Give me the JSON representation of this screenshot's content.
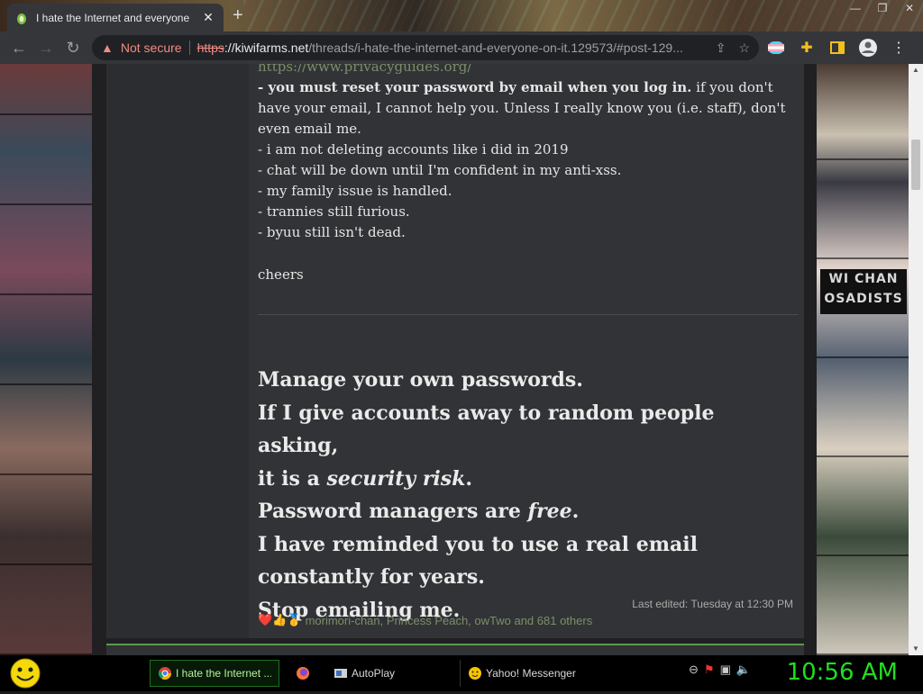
{
  "browser": {
    "tab_title": "I hate the Internet and everyone",
    "new_tab_symbol": "+",
    "security_label": "Not secure",
    "url_scheme": "https",
    "url_host": "://kiwifarms.net",
    "url_path": "/threads/i-hate-the-internet-and-everyone-on-it.129573/#post-129...",
    "colors": {
      "chrome": "#35363a",
      "omnibox": "#202124",
      "warning": "#f28b82"
    }
  },
  "post": {
    "link": "https://www.privacyguides.org/",
    "reset_bold": "- you must reset your password by email when you log in.",
    "reset_rest": " if you don't have your email, I cannot help you. Unless I really know you (i.e. staff), don't even email me.",
    "bullets": [
      "- i am not deleting accounts like i did in 2019",
      "- chat will be down until I'm confident in my anti-xss.",
      "- my family issue is handled.",
      "- trannies still furious.",
      "- byuu still isn't dead."
    ],
    "signoff": "cheers",
    "big": {
      "l1": "Manage your own passwords.",
      "l2": "If I give accounts away to random people asking,",
      "l3a": "it is a ",
      "l3b": "security risk",
      "l3c": ".",
      "l4a": "Password managers are ",
      "l4b": "free",
      "l4c": ".",
      "l5": "I have reminded you to use a real email",
      "l6": "constantly for years.",
      "l7": "Stop emailing me."
    },
    "last_edited": "Last edited: Tuesday at 12:30 PM",
    "reaction_icons": "❤️👍🥇",
    "reactions": "morimori-chan, Princess Peach, owTwo and 681 others"
  },
  "sidebar_banner": "WI CHAN\nOSADISTS",
  "taskbar": {
    "chrome_task": "I hate the Internet ...",
    "autoplay_task": "AutoPlay",
    "yahoo_task": "Yahoo! Messenger",
    "clock": "10:56 AM",
    "clock_color": "#22dd22"
  }
}
